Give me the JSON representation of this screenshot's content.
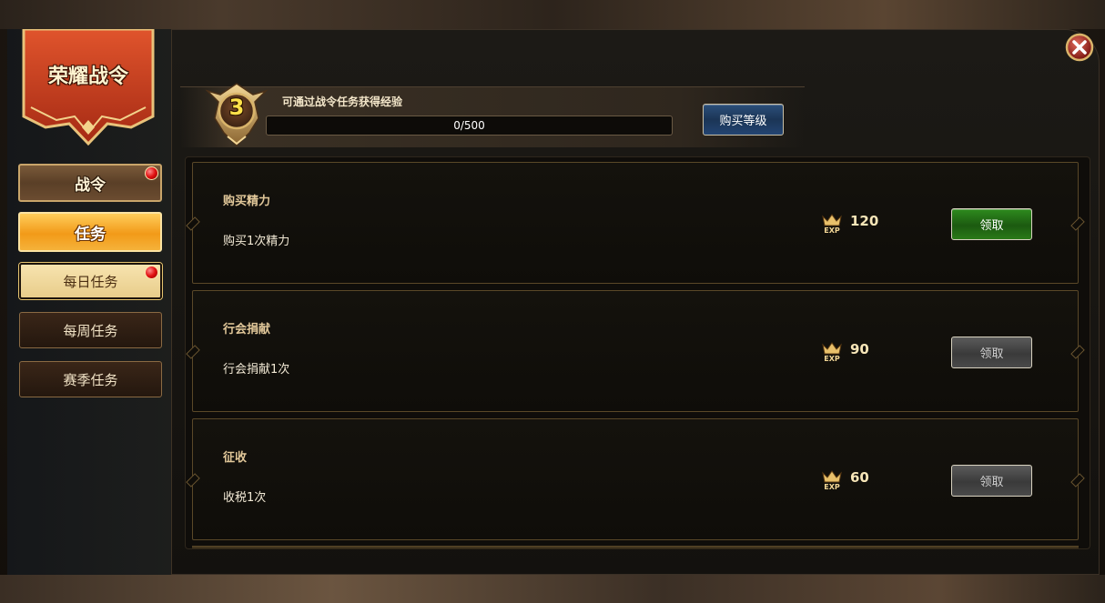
{
  "banner": {
    "title": "荣耀战令"
  },
  "nav": {
    "main_label": "战令",
    "task_label": "任务",
    "sub_items": [
      {
        "label": "每日任务",
        "selected": true,
        "has_dot": true
      },
      {
        "label": "每周任务",
        "selected": false,
        "has_dot": false
      },
      {
        "label": "赛季任务",
        "selected": false,
        "has_dot": false
      }
    ]
  },
  "header": {
    "level": "3",
    "exp_hint": "可通过战令任务获得经验",
    "exp_text": "0/500",
    "exp_progress": 0,
    "buy_level_label": "购买等级"
  },
  "tasks": [
    {
      "title": "购买精力",
      "desc": "购买1次精力",
      "exp": "120",
      "claim_label": "领取",
      "claimable": true
    },
    {
      "title": "行会捐献",
      "desc": "行会捐献1次",
      "exp": "90",
      "claim_label": "领取",
      "claimable": false
    },
    {
      "title": "征收",
      "desc": "收税1次",
      "exp": "60",
      "claim_label": "领取",
      "claimable": false
    }
  ],
  "icons": {
    "close": "close-icon",
    "exp": "exp-icon",
    "level_badge": "level-badge-icon",
    "notification": "red-dot-icon"
  },
  "colors": {
    "accent_gold": "#c9a56a",
    "active_orange": "#f29a18",
    "claim_green": "#2e8a1e",
    "buy_blue": "#1b3556",
    "banner_red": "#c23a1e"
  }
}
